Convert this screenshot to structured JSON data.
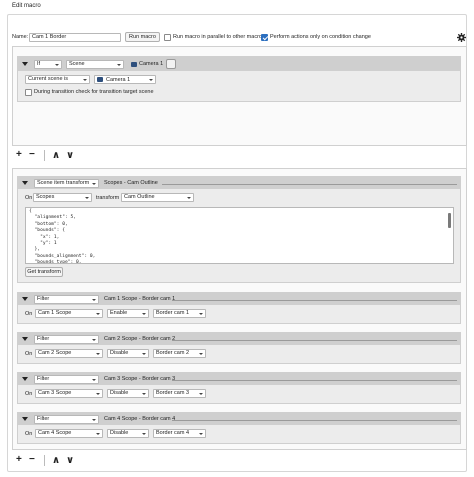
{
  "window": {
    "group_title": "Edit macro"
  },
  "header": {
    "name_label": "Name:",
    "name_value": "Cam 1 Border",
    "run_button": "Run macro",
    "parallel_label": "Run macro in parallel to other macros",
    "parallel_checked": false,
    "condition_label": "Perform actions only on condition change",
    "condition_checked": true,
    "settings_icon": "gear-icon"
  },
  "condition": {
    "type_value": "If",
    "source_value": "Scene",
    "scene_display": "Camera 1",
    "check_value": "Current scene is",
    "scene_value": "Camera 1",
    "transition_label": "During transition check for transition target scene"
  },
  "toolbar_top": {
    "add": "+",
    "remove": "−",
    "up": "∧",
    "down": "∨"
  },
  "action1": {
    "type_value": "Scene item transform",
    "title": "Scopes - Cam Outline",
    "on_label": "On",
    "scene_value": "Scopes",
    "transform_label": "transform",
    "source_value": "Cam Outline",
    "json_text": "{\n  \"alignment\": 5,\n  \"bottom\": 0,\n  \"bounds\": {\n    \"x\": 1,\n    \"y\": 1\n  },\n  \"bounds_alignment\": 0,\n  \"bounds_type\": 0,",
    "get_transform_button": "Get transform"
  },
  "filters": [
    {
      "type_value": "Filter",
      "title": "Cam 1 Scope - Border cam 1",
      "on_label": "On",
      "source": "Cam 1 Scope",
      "action": "Enable",
      "filter": "Border cam 1"
    },
    {
      "type_value": "Filter",
      "title": "Cam 2 Scope - Border cam 2",
      "on_label": "On",
      "source": "Cam 2 Scope",
      "action": "Disable",
      "filter": "Border cam 2"
    },
    {
      "type_value": "Filter",
      "title": "Cam 3 Scope - Border cam 3",
      "on_label": "On",
      "source": "Cam 3 Scope",
      "action": "Disable",
      "filter": "Border cam 3"
    },
    {
      "type_value": "Filter",
      "title": "Cam 4 Scope - Border cam 4",
      "on_label": "On",
      "source": "Cam 4 Scope",
      "action": "Disable",
      "filter": "Border cam 4"
    }
  ],
  "toolbar_bottom": {
    "add": "+",
    "remove": "−",
    "up": "∧",
    "down": "∨"
  }
}
